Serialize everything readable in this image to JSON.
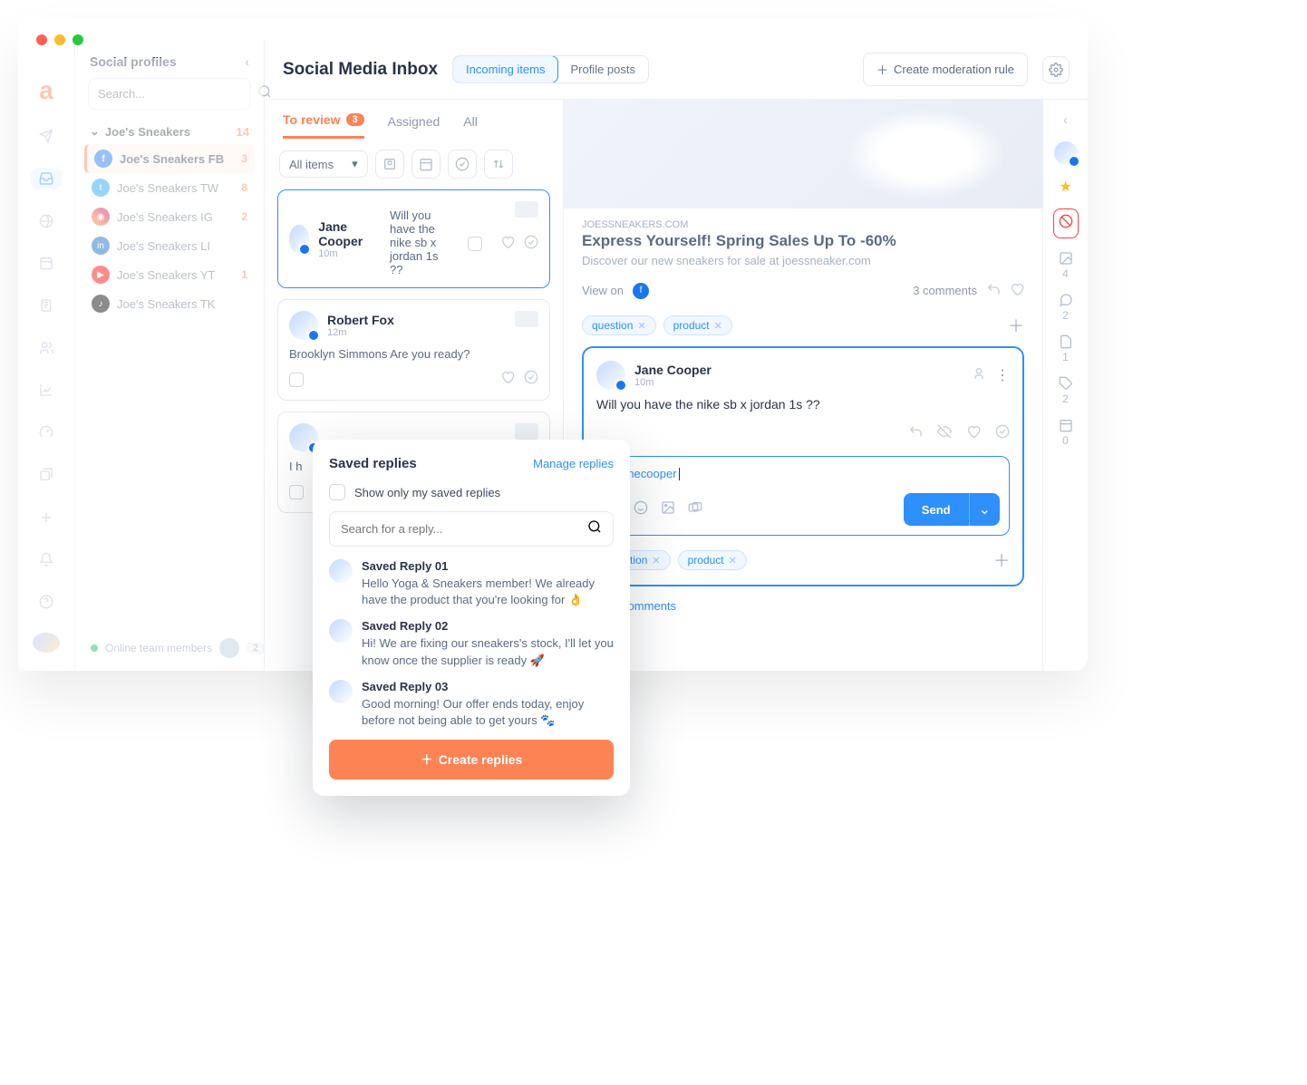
{
  "rail_icons": [
    "send",
    "inbox",
    "globe",
    "calendar",
    "clipboard",
    "users",
    "bars",
    "gauge",
    "library",
    "plus",
    "bell",
    "help"
  ],
  "profiles_header": "Social profiles",
  "search_placeholder": "Search...",
  "group_name": "Joe's Sneakers",
  "group_count": "14",
  "profiles": [
    {
      "name": "Joe's Sneakers FB",
      "net": "fb",
      "count": "3",
      "active": true
    },
    {
      "name": "Joe's Sneakers TW",
      "net": "tw",
      "count": "8"
    },
    {
      "name": "Joe's Sneakers IG",
      "net": "ig",
      "count": "2"
    },
    {
      "name": "Joe's Sneakers LI",
      "net": "li",
      "count": ""
    },
    {
      "name": "Joe's Sneakers YT",
      "net": "yt",
      "count": "1"
    },
    {
      "name": "Joe's Sneakers TK",
      "net": "tk",
      "count": ""
    }
  ],
  "online_label": "Online team members",
  "online_count": "2",
  "page_title": "Social Media Inbox",
  "seg": [
    "Incoming items",
    "Profile posts"
  ],
  "create_rule": "Create moderation rule",
  "tabs": [
    {
      "label": "To review",
      "count": "3",
      "active": true
    },
    {
      "label": "Assigned"
    },
    {
      "label": "All"
    }
  ],
  "filter_label": "All items",
  "items": [
    {
      "name": "Jane Cooper",
      "time": "10m",
      "msg": "Will you have the nike sb x jordan 1s ??",
      "sel": true
    },
    {
      "name": "Robert Fox",
      "time": "12m",
      "msg": "Brooklyn Simmons Are you ready?"
    },
    {
      "name": "",
      "time": "",
      "msg": "I h"
    }
  ],
  "post_link": "JOESSNEAKERS.COM",
  "post_title": "Express Yourself! Spring Sales Up To -60%",
  "post_desc": "Discover our new sneakers for sale at joessneaker.com",
  "view_on": "View on",
  "comments_count": "3 comments",
  "tags_top": [
    "question",
    "product"
  ],
  "comment": {
    "name": "Jane Cooper",
    "time": "10m",
    "msg": "Will you have the nike sb x jordan 1s ??"
  },
  "reply_mention": "@janecooper",
  "send_label": "Send",
  "tags_bottom": [
    "question",
    "product"
  ],
  "more_comments": "2 more comments",
  "rrail_counts": {
    "img": "4",
    "chat": "2",
    "note": "1",
    "tag": "2",
    "cal": "0"
  },
  "popup": {
    "title": "Saved replies",
    "manage": "Manage replies",
    "show_mine": "Show only my saved replies",
    "search_ph": "Search for a reply...",
    "replies": [
      {
        "name": "Saved Reply 01",
        "body": "Hello Yoga & Sneakers member! We already have the product that you're looking for 👌"
      },
      {
        "name": "Saved Reply 02",
        "body": "Hi! We are fixing our sneakers's stock, I'll let you know once the supplier is ready 🚀"
      },
      {
        "name": "Saved Reply 03",
        "body": "Good morning! Our offer ends today, enjoy before not being able to get yours 🐾"
      }
    ],
    "create": "Create replies"
  }
}
